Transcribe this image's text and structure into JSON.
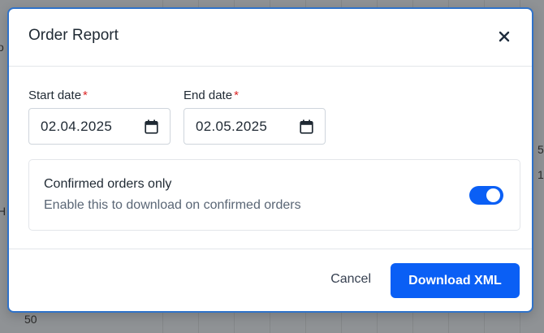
{
  "background": {
    "fragments": [
      "o",
      "H",
      "5",
      "1",
      "50"
    ]
  },
  "modal": {
    "title": "Order Report",
    "close_icon": "close-icon",
    "start_date": {
      "label": "Start date",
      "required_mark": "*",
      "value": "02.04.2025",
      "icon": "calendar-icon"
    },
    "end_date": {
      "label": "End date",
      "required_mark": "*",
      "value": "02.05.2025",
      "icon": "calendar-icon"
    },
    "confirmed_toggle": {
      "title": "Confirmed orders only",
      "description": "Enable this to download on confirmed orders",
      "enabled": true
    },
    "footer": {
      "cancel_label": "Cancel",
      "download_label": "Download XML"
    }
  },
  "colors": {
    "primary": "#0a5ff5",
    "required": "#dc2626",
    "modal_border": "#2f72c9"
  }
}
